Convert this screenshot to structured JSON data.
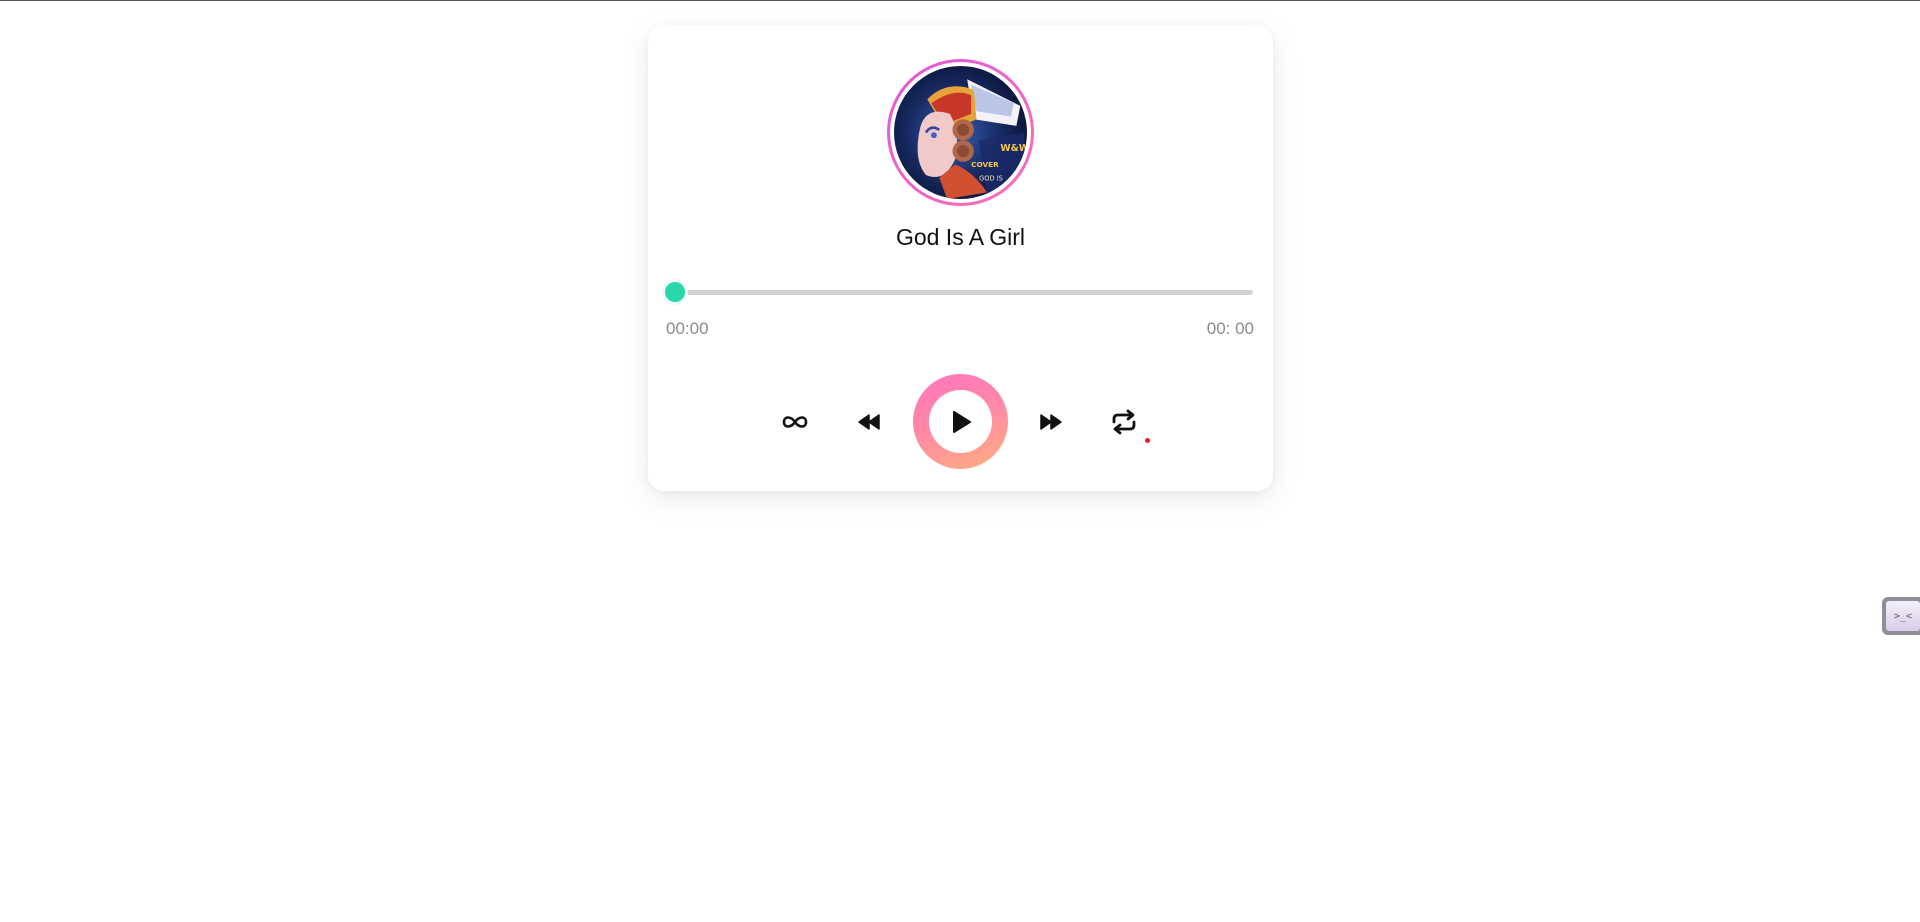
{
  "player": {
    "cover_icon": "album-cover-art",
    "cover_text": "W&W COVER",
    "title": "God Is A Girl",
    "progress": {
      "fraction": 0.0,
      "current_time": "00:00",
      "total_time": "00: 00"
    },
    "controls": {
      "loop_icon": "infinity-icon",
      "prev_icon": "rewind-icon",
      "play_icon": "play-icon",
      "next_icon": "fast-forward-icon",
      "repeat_icon": "repeat-icon"
    },
    "colors": {
      "accent": "#2ad6ac",
      "play_gradient_start": "#ff74c0",
      "play_gradient_end": "#ffb07e",
      "cover_ring": "#e255d8",
      "indicator": "#ee1b1b"
    }
  },
  "side_widget": {
    "icon": "terminal-icon",
    "label": ">_<"
  }
}
